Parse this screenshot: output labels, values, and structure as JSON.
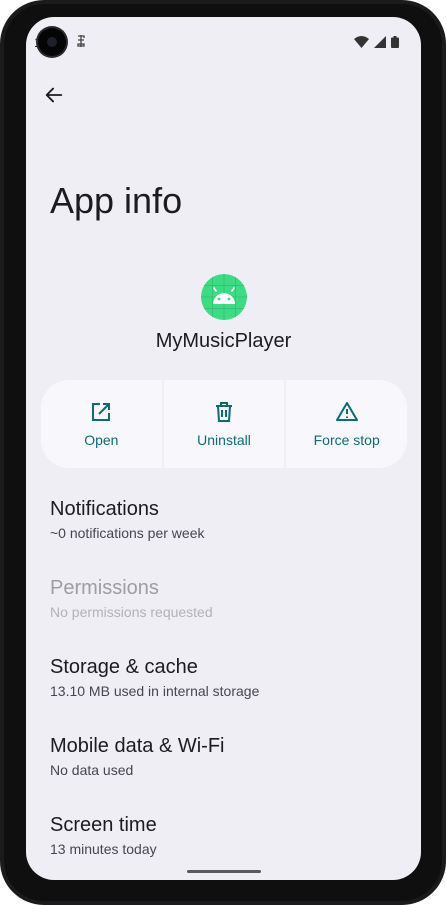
{
  "status_bar": {
    "time": "1"
  },
  "header": {
    "title": "App info"
  },
  "app": {
    "name": "MyMusicPlayer",
    "icon": "android-icon",
    "icon_bg": "#3ddc84"
  },
  "actions": [
    {
      "label": "Open",
      "icon": "open-in-new-icon"
    },
    {
      "label": "Uninstall",
      "icon": "trash-icon"
    },
    {
      "label": "Force stop",
      "icon": "warning-icon"
    }
  ],
  "settings": [
    {
      "title": "Notifications",
      "summary": "~0 notifications per week",
      "enabled": true
    },
    {
      "title": "Permissions",
      "summary": "No permissions requested",
      "enabled": false
    },
    {
      "title": "Storage & cache",
      "summary": "13.10 MB used in internal storage",
      "enabled": true
    },
    {
      "title": "Mobile data & Wi-Fi",
      "summary": "No data used",
      "enabled": true
    },
    {
      "title": "Screen time",
      "summary": "13 minutes today",
      "enabled": true
    }
  ],
  "colors": {
    "accent": "#0b6b7a",
    "background": "#efeef4",
    "card": "#f8f8fc"
  }
}
